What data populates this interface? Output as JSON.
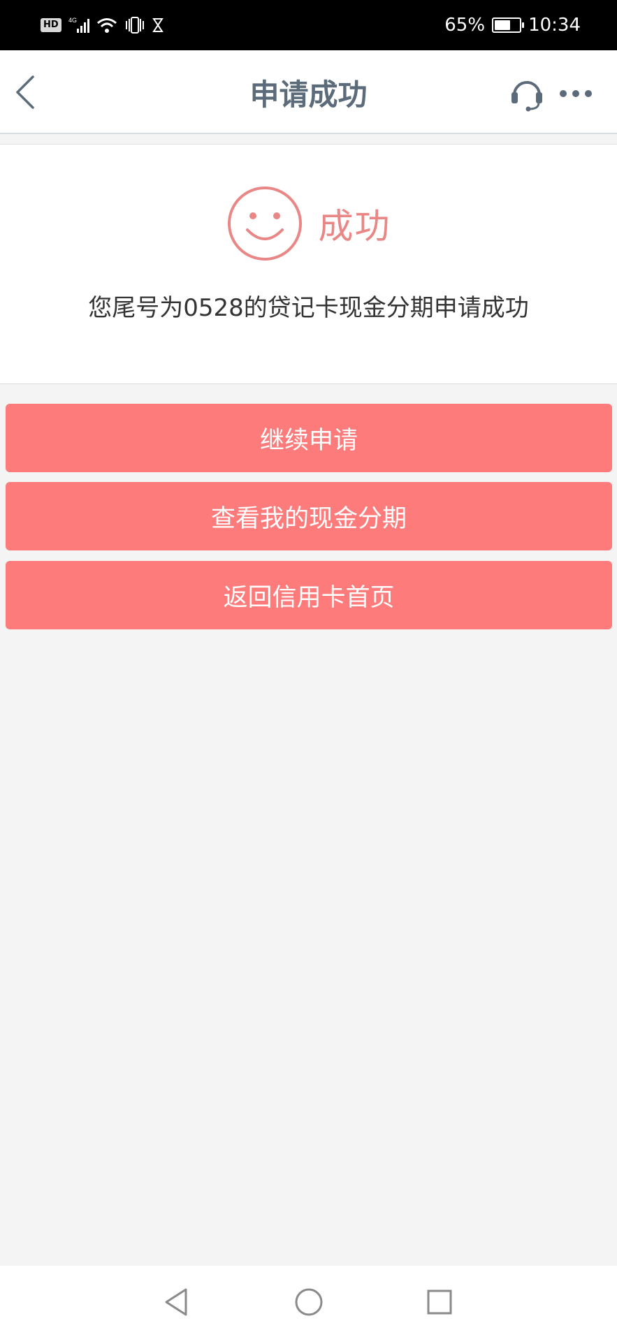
{
  "status_bar": {
    "hd": "HD",
    "network": "4G",
    "battery_percent": "65%",
    "battery_level": 0.65,
    "time": "10:34",
    "icons": [
      "hd-icon",
      "signal-icon",
      "wifi-icon",
      "vibrate-icon",
      "hourglass-icon",
      "battery-icon"
    ]
  },
  "header": {
    "title": "申请成功",
    "back_icon": "chevron-left-icon",
    "customer_service_icon": "headset-icon",
    "more_icon": "more-dots-icon"
  },
  "result": {
    "icon": "smile-icon",
    "status_text": "成功",
    "message": "您尾号为0528的贷记卡现金分期申请成功"
  },
  "actions": [
    {
      "label": "继续申请"
    },
    {
      "label": "查看我的现金分期"
    },
    {
      "label": "返回信用卡首页"
    }
  ],
  "colors": {
    "accent": "#fd7b7b",
    "success_text": "#e98787",
    "header_title": "#5b6b7a",
    "page_background": "#f4f4f4"
  },
  "nav_bar": {
    "icons": [
      "triangle-back-icon",
      "circle-home-icon",
      "square-recent-icon"
    ]
  }
}
